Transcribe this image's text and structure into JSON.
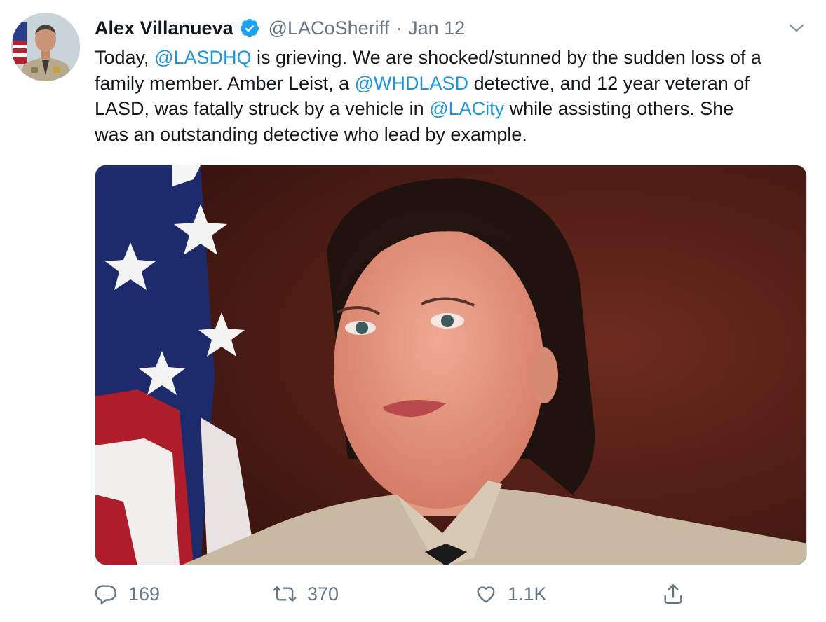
{
  "author": {
    "name": "Alex Villanueva",
    "handle": "@LACoSheriff",
    "separator": "·",
    "date": "Jan 12",
    "verified": true
  },
  "tweet": {
    "lines": [
      [
        {
          "text": "Today, ",
          "mention": false
        },
        {
          "text": "@LASDHQ",
          "mention": true
        },
        {
          "text": " is grieving. We are shocked/stunned by the sudden loss of a",
          "mention": false
        }
      ],
      [
        {
          "text": "family member. Amber Leist, a ",
          "mention": false
        },
        {
          "text": "@WHDLASD",
          "mention": true
        },
        {
          "text": " detective, and 12 year veteran of",
          "mention": false
        }
      ],
      [
        {
          "text": "LASD, was fatally struck by a vehicle in ",
          "mention": false
        },
        {
          "text": "@LACity",
          "mention": true
        },
        {
          "text": " while assisting others. She",
          "mention": false
        }
      ],
      [
        {
          "text": "was an outstanding detective who lead by example.",
          "mention": false
        }
      ]
    ]
  },
  "actions": {
    "reply_count": "169",
    "retweet_count": "370",
    "like_count": "1.1K"
  },
  "icons": {
    "verified": "verified-badge-icon",
    "caret": "chevron-down-icon",
    "reply": "reply-icon",
    "retweet": "retweet-icon",
    "like": "heart-icon",
    "share": "share-icon"
  },
  "colors": {
    "mention": "#1b95e0",
    "secondary_text": "#657786",
    "verified": "#1da1f2"
  }
}
